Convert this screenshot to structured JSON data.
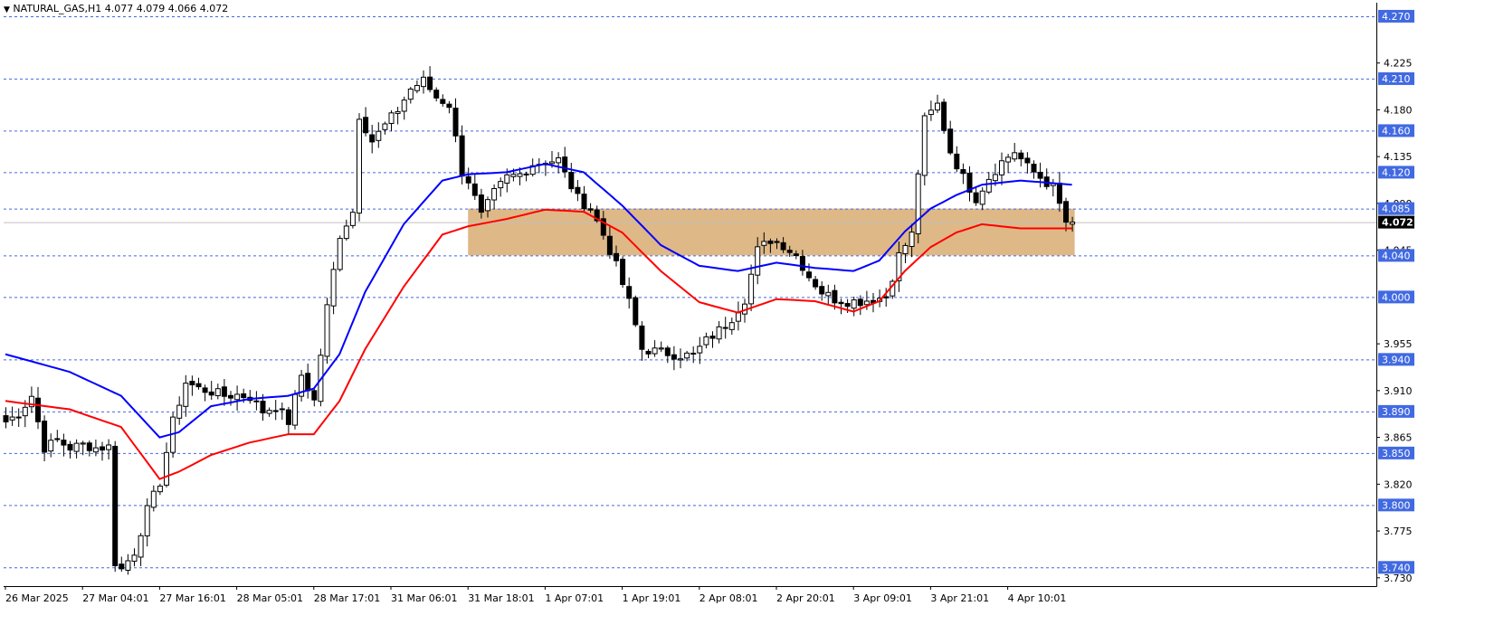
{
  "header": {
    "symbol_label": "NATURAL_GAS,H1",
    "ohlc_text": "4.077 4.079 4.066 4.072",
    "triangle_icon": "triangle-down-icon"
  },
  "colors": {
    "bull_candle": "#ffffff",
    "bear_candle": "#000000",
    "ema_fast": "#0000ff",
    "ema_slow": "#ff0000",
    "zone_fill": "#deb887",
    "level_line": "#4169e1",
    "price_tag_bg": "#4169e1",
    "current_price_bg": "#000000"
  },
  "chart_data": {
    "type": "candlestick",
    "title": "",
    "xlabel": "",
    "ylabel": "",
    "symbol": "NATURAL_GAS",
    "timeframe": "H1",
    "ylim": [
      3.722,
      4.283
    ],
    "price_ticks": [
      4.225,
      4.18,
      4.135,
      4.09,
      4.045,
      3.955,
      3.91,
      3.865,
      3.82,
      3.775,
      3.73
    ],
    "level_lines": [
      4.27,
      4.21,
      4.16,
      4.12,
      4.085,
      4.04,
      4.0,
      3.94,
      3.89,
      3.85,
      3.8,
      3.74
    ],
    "current_price": 4.072,
    "zone": {
      "from_bar": 72,
      "to_bar": 166,
      "low": 4.04,
      "high": 4.085
    },
    "time_labels": [
      {
        "bar": 0,
        "text": "26 Mar 2025"
      },
      {
        "bar": 12,
        "text": "27 Mar 04:01"
      },
      {
        "bar": 24,
        "text": "27 Mar 16:01"
      },
      {
        "bar": 36,
        "text": "28 Mar 05:01"
      },
      {
        "bar": 48,
        "text": "28 Mar 17:01"
      },
      {
        "bar": 60,
        "text": "31 Mar 06:01"
      },
      {
        "bar": 72,
        "text": "31 Mar 18:01"
      },
      {
        "bar": 84,
        "text": "1 Apr 07:01"
      },
      {
        "bar": 96,
        "text": "1 Apr 19:01"
      },
      {
        "bar": 108,
        "text": "2 Apr 08:01"
      },
      {
        "bar": 120,
        "text": "2 Apr 20:01"
      },
      {
        "bar": 132,
        "text": "3 Apr 09:01"
      },
      {
        "bar": 144,
        "text": "3 Apr 21:01"
      },
      {
        "bar": 156,
        "text": "4 Apr 10:01"
      }
    ],
    "close_anchors": [
      [
        0,
        3.88
      ],
      [
        2,
        3.888
      ],
      [
        4,
        3.905
      ],
      [
        6,
        3.855
      ],
      [
        8,
        3.862
      ],
      [
        10,
        3.855
      ],
      [
        12,
        3.858
      ],
      [
        14,
        3.855
      ],
      [
        16,
        3.856
      ],
      [
        17,
        3.745
      ],
      [
        18,
        3.738
      ],
      [
        20,
        3.755
      ],
      [
        22,
        3.795
      ],
      [
        24,
        3.822
      ],
      [
        26,
        3.88
      ],
      [
        28,
        3.918
      ],
      [
        30,
        3.912
      ],
      [
        32,
        3.909
      ],
      [
        34,
        3.905
      ],
      [
        36,
        3.906
      ],
      [
        38,
        3.904
      ],
      [
        40,
        3.89
      ],
      [
        42,
        3.895
      ],
      [
        44,
        3.88
      ],
      [
        46,
        3.925
      ],
      [
        48,
        3.9
      ],
      [
        50,
        3.99
      ],
      [
        52,
        4.06
      ],
      [
        54,
        4.082
      ],
      [
        55,
        4.175
      ],
      [
        57,
        4.15
      ],
      [
        59,
        4.165
      ],
      [
        61,
        4.18
      ],
      [
        63,
        4.2
      ],
      [
        65,
        4.208
      ],
      [
        67,
        4.192
      ],
      [
        69,
        4.185
      ],
      [
        71,
        4.12
      ],
      [
        72,
        4.112
      ],
      [
        74,
        4.078
      ],
      [
        76,
        4.1
      ],
      [
        78,
        4.115
      ],
      [
        80,
        4.118
      ],
      [
        82,
        4.128
      ],
      [
        84,
        4.13
      ],
      [
        86,
        4.132
      ],
      [
        87,
        4.118
      ],
      [
        89,
        4.095
      ],
      [
        91,
        4.085
      ],
      [
        93,
        4.06
      ],
      [
        95,
        4.03
      ],
      [
        97,
        3.995
      ],
      [
        99,
        3.95
      ],
      [
        101,
        3.948
      ],
      [
        103,
        3.946
      ],
      [
        105,
        3.944
      ],
      [
        107,
        3.944
      ],
      [
        109,
        3.958
      ],
      [
        111,
        3.968
      ],
      [
        113,
        3.98
      ],
      [
        115,
        3.998
      ],
      [
        117,
        4.045
      ],
      [
        119,
        4.055
      ],
      [
        121,
        4.05
      ],
      [
        123,
        4.04
      ],
      [
        125,
        4.02
      ],
      [
        127,
        4.005
      ],
      [
        129,
        3.998
      ],
      [
        131,
        3.996
      ],
      [
        133,
        3.996
      ],
      [
        135,
        3.998
      ],
      [
        137,
        4.0
      ],
      [
        139,
        4.04
      ],
      [
        141,
        4.06
      ],
      [
        142,
        4.12
      ],
      [
        143,
        4.17
      ],
      [
        145,
        4.185
      ],
      [
        147,
        4.14
      ],
      [
        149,
        4.115
      ],
      [
        151,
        4.095
      ],
      [
        153,
        4.115
      ],
      [
        155,
        4.13
      ],
      [
        157,
        4.14
      ],
      [
        159,
        4.125
      ],
      [
        161,
        4.115
      ],
      [
        163,
        4.105
      ],
      [
        165,
        4.072
      ],
      [
        166,
        4.072
      ]
    ],
    "series": [
      {
        "name": "",
        "color": "#0000ff",
        "points": [
          [
            0,
            3.945
          ],
          [
            10,
            3.928
          ],
          [
            18,
            3.905
          ],
          [
            24,
            3.865
          ],
          [
            27,
            3.87
          ],
          [
            32,
            3.895
          ],
          [
            38,
            3.902
          ],
          [
            44,
            3.905
          ],
          [
            48,
            3.912
          ],
          [
            52,
            3.945
          ],
          [
            56,
            4.005
          ],
          [
            62,
            4.07
          ],
          [
            68,
            4.112
          ],
          [
            72,
            4.118
          ],
          [
            78,
            4.12
          ],
          [
            84,
            4.128
          ],
          [
            90,
            4.12
          ],
          [
            96,
            4.088
          ],
          [
            102,
            4.05
          ],
          [
            108,
            4.03
          ],
          [
            114,
            4.025
          ],
          [
            120,
            4.033
          ],
          [
            126,
            4.028
          ],
          [
            132,
            4.025
          ],
          [
            136,
            4.035
          ],
          [
            140,
            4.063
          ],
          [
            144,
            4.085
          ],
          [
            148,
            4.098
          ],
          [
            152,
            4.108
          ],
          [
            158,
            4.112
          ],
          [
            166,
            4.108
          ]
        ]
      },
      {
        "name": "",
        "color": "#ff0000",
        "points": [
          [
            0,
            3.9
          ],
          [
            10,
            3.892
          ],
          [
            18,
            3.875
          ],
          [
            24,
            3.825
          ],
          [
            27,
            3.832
          ],
          [
            32,
            3.848
          ],
          [
            38,
            3.86
          ],
          [
            44,
            3.868
          ],
          [
            48,
            3.868
          ],
          [
            52,
            3.9
          ],
          [
            56,
            3.95
          ],
          [
            62,
            4.01
          ],
          [
            68,
            4.06
          ],
          [
            72,
            4.068
          ],
          [
            78,
            4.075
          ],
          [
            84,
            4.084
          ],
          [
            90,
            4.082
          ],
          [
            96,
            4.062
          ],
          [
            102,
            4.025
          ],
          [
            108,
            3.995
          ],
          [
            114,
            3.985
          ],
          [
            120,
            3.998
          ],
          [
            126,
            3.996
          ],
          [
            132,
            3.986
          ],
          [
            136,
            3.996
          ],
          [
            140,
            4.025
          ],
          [
            144,
            4.048
          ],
          [
            148,
            4.062
          ],
          [
            152,
            4.07
          ],
          [
            158,
            4.066
          ],
          [
            166,
            4.066
          ]
        ]
      }
    ]
  }
}
